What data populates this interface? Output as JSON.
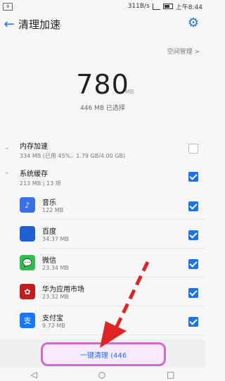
{
  "statusbar": {
    "left_badge": "9",
    "speed": "311B/s",
    "time": "上午8:44"
  },
  "appbar": {
    "title": "清理加速"
  },
  "space_link": "空间管理 >",
  "summary": {
    "value": "780",
    "unit": "MB",
    "selected_text": "446 MB 已选择"
  },
  "sections": {
    "memory": {
      "title": "内存加速",
      "subtitle": "334 MB (已用 45%，1.79 GB/4.00 GB)"
    },
    "cache": {
      "title": "系统缓存",
      "subtitle": "213 MB | 13 项"
    }
  },
  "apps": [
    {
      "name": "音乐",
      "size": "122 MB",
      "color": "#3a6fe8",
      "icon": "music-icon"
    },
    {
      "name": "百度",
      "size": "34.37 MB",
      "color": "#1f5fd6",
      "icon": "baidu-icon"
    },
    {
      "name": "微信",
      "size": "23.34 MB",
      "color": "#2bbf4e",
      "icon": "wechat-icon"
    },
    {
      "name": "华为应用市场",
      "size": "23.32 MB",
      "color": "#c21c1c",
      "icon": "huawei-icon"
    },
    {
      "name": "支付宝",
      "size": "9.72 MB",
      "color": "#1677ff",
      "icon": "alipay-icon"
    }
  ],
  "bottom": {
    "clean_label": "一键清理 (446"
  },
  "nav": {
    "back": "◁",
    "home": "○",
    "recent": "□"
  },
  "colors": {
    "accent": "#1a73e8",
    "annotation": "#e02424",
    "highlight": "#d06ad0"
  }
}
